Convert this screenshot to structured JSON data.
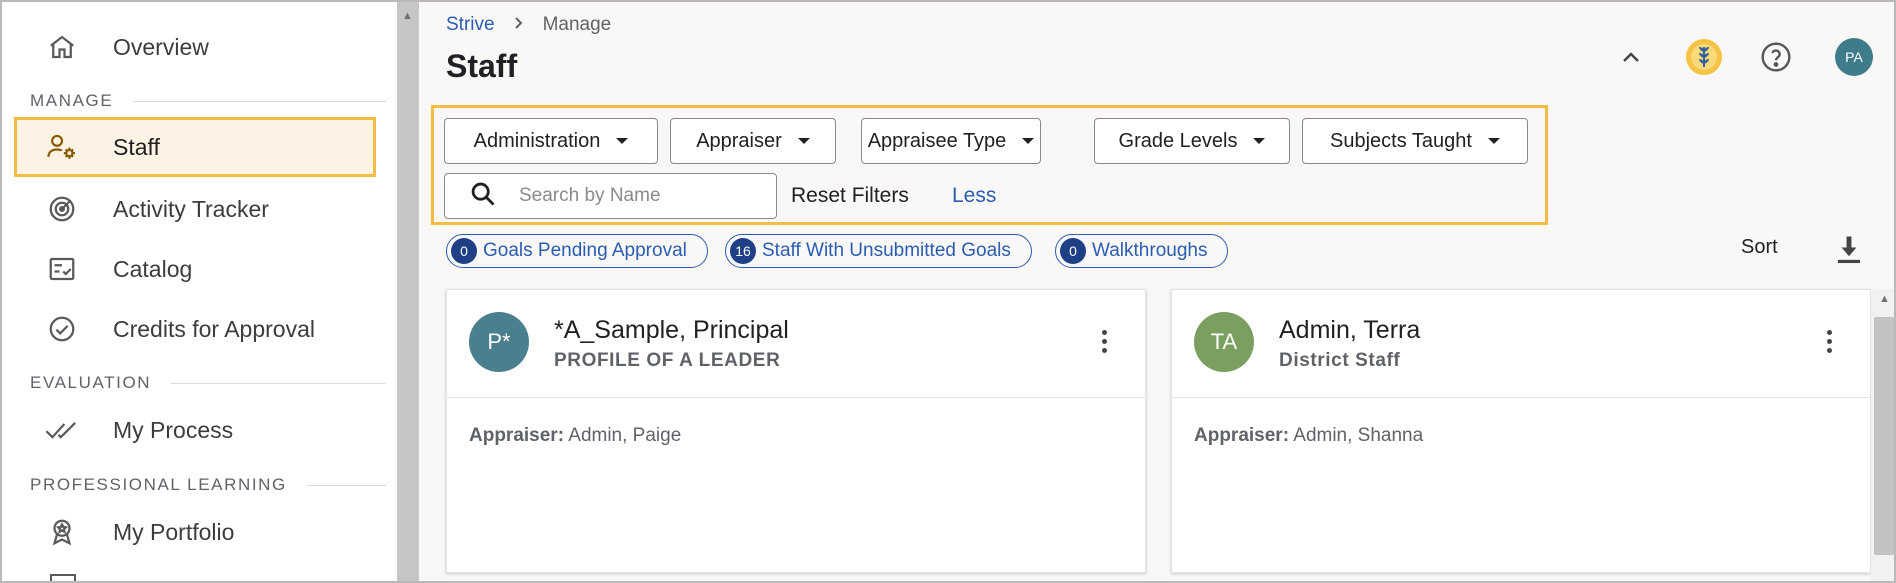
{
  "sidebar": {
    "items": [
      {
        "label": "Overview",
        "icon": "home-icon"
      },
      {
        "label": "Staff",
        "icon": "user-gear-icon",
        "active": true
      },
      {
        "label": "Activity Tracker",
        "icon": "target-icon"
      },
      {
        "label": "Catalog",
        "icon": "checklist-icon"
      },
      {
        "label": "Credits for Approval",
        "icon": "check-circle-icon"
      },
      {
        "label": "My Process",
        "icon": "double-check-icon"
      },
      {
        "label": "My Portfolio",
        "icon": "award-icon"
      }
    ],
    "sections": {
      "manage": "MANAGE",
      "evaluation": "EVALUATION",
      "professional_learning": "PROFESSIONAL LEARNING"
    }
  },
  "breadcrumb": {
    "root": "Strive",
    "current": "Manage"
  },
  "page_title": "Staff",
  "header": {
    "user_initials": "PA"
  },
  "filters": {
    "dropdowns": [
      "Administration",
      "Appraiser",
      "Appraisee Type",
      "Grade Levels",
      "Subjects Taught"
    ],
    "search_placeholder": "Search by Name",
    "reset_label": "Reset Filters",
    "less_label": "Less"
  },
  "chips": [
    {
      "count": "0",
      "label": "Goals Pending Approval"
    },
    {
      "count": "16",
      "label": "Staff With Unsubmitted Goals"
    },
    {
      "count": "0",
      "label": "Walkthroughs"
    }
  ],
  "sort_label": "Sort",
  "cards": [
    {
      "initials": "P*",
      "name": "*A_Sample, Principal",
      "role": "PROFILE OF A LEADER",
      "appraiser_label": "Appraiser:",
      "appraiser": "Admin, Paige",
      "color": "#4a7f8e"
    },
    {
      "initials": "TA",
      "name": "Admin, Terra",
      "role": "District Staff",
      "appraiser_label": "Appraiser:",
      "appraiser": "Admin, Shanna",
      "color": "#7a9f5f"
    }
  ],
  "colors": {
    "accent": "#f2bd44",
    "link": "#2a5db0",
    "chip_count_bg": "#1f3f86"
  }
}
